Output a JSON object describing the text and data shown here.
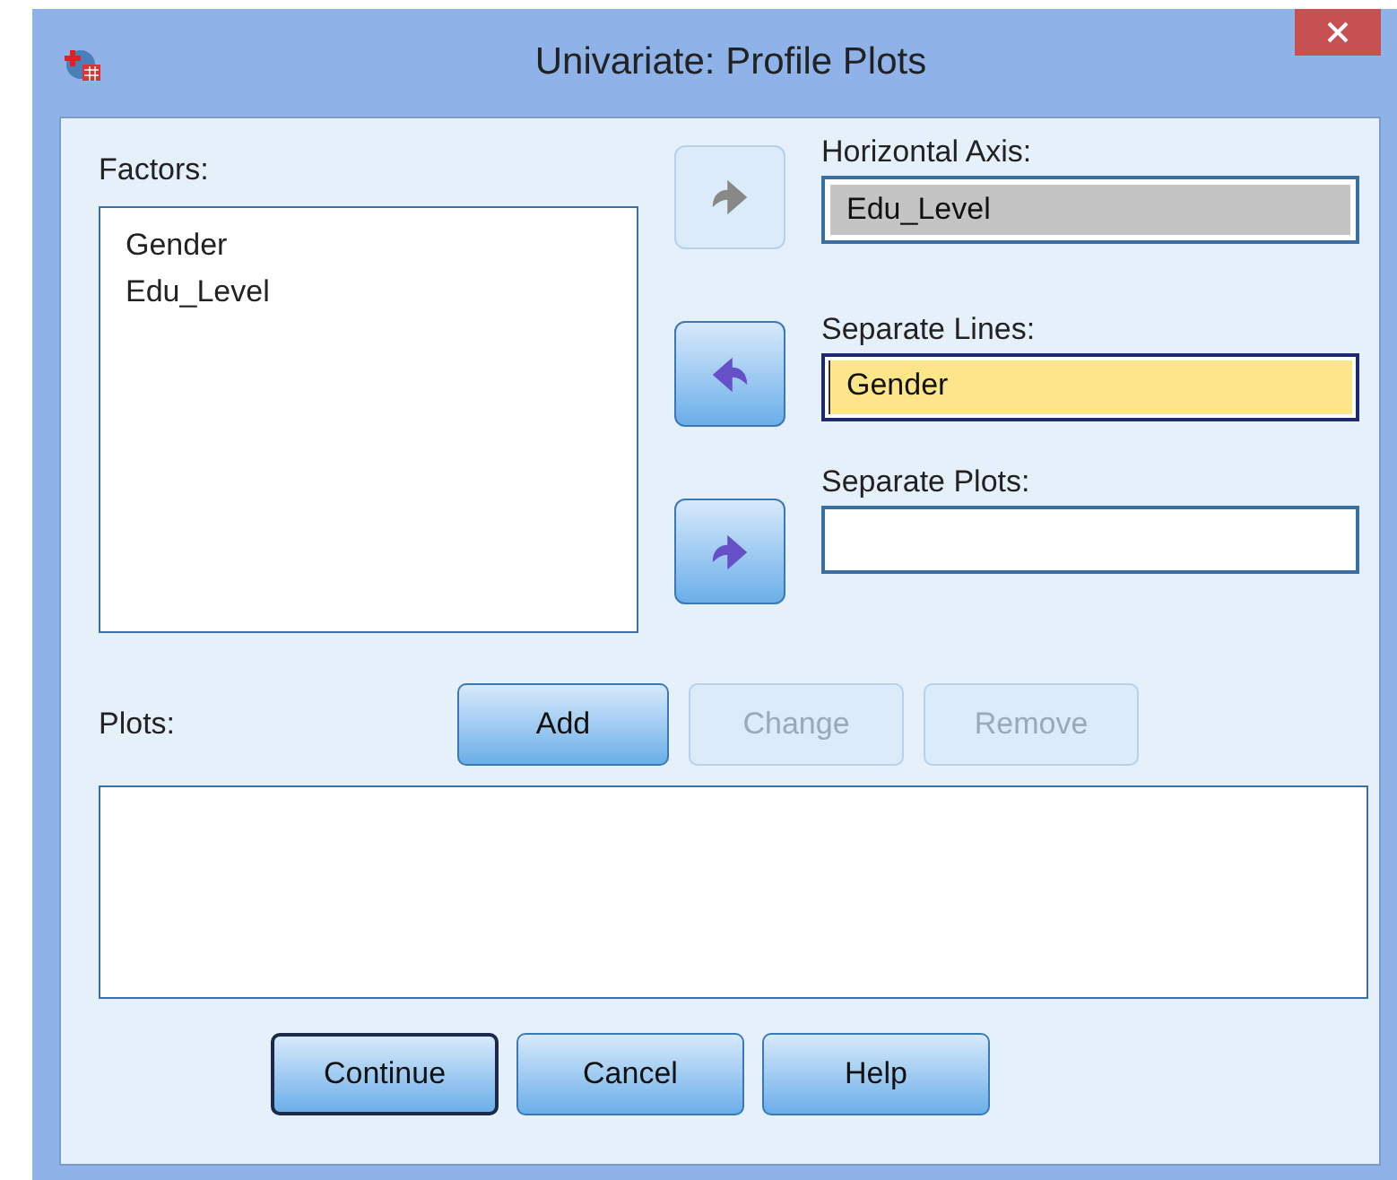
{
  "window": {
    "title": "Univariate: Profile Plots"
  },
  "factors": {
    "label": "Factors:",
    "items": [
      "Gender",
      "Edu_Level"
    ]
  },
  "move_buttons": [
    {
      "kind": "right",
      "disabled": true
    },
    {
      "kind": "left",
      "disabled": false
    },
    {
      "kind": "right",
      "disabled": false
    }
  ],
  "targets": [
    {
      "label": "Horizontal Axis:",
      "value": "Edu_Level",
      "kind": "filled"
    },
    {
      "label": "Separate Lines:",
      "value": "Gender",
      "kind": "focused"
    },
    {
      "label": "Separate Plots:",
      "kind": "empty"
    }
  ],
  "plots": {
    "label": "Plots:",
    "buttons": [
      {
        "label": "Add",
        "disabled": false
      },
      {
        "label": "Change",
        "disabled": true
      },
      {
        "label": "Remove",
        "disabled": true
      }
    ]
  },
  "footer_buttons": [
    {
      "label": "Continue",
      "default": true
    },
    {
      "label": "Cancel",
      "default": false
    },
    {
      "label": "Help",
      "default": false
    }
  ]
}
